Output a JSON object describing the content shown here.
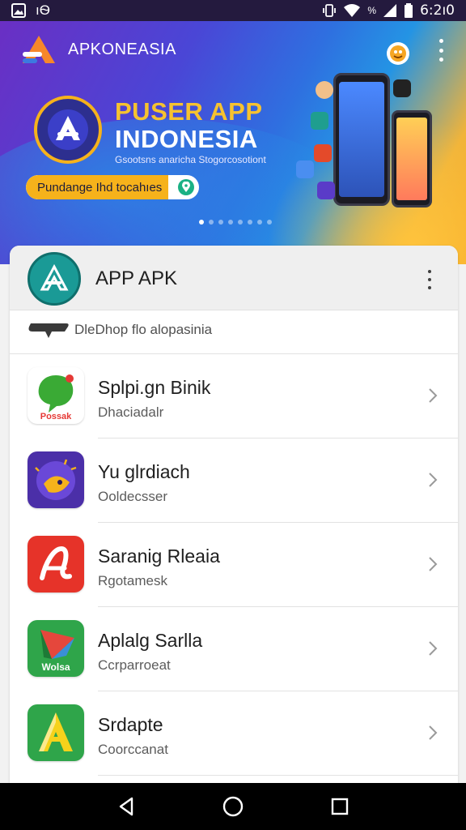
{
  "status_bar": {
    "left_icons": [
      "image-icon",
      "notification-icon"
    ],
    "left_text": "ıѲ",
    "right_icons": [
      "vibrate-icon",
      "wifi-icon",
      "signal-icon",
      "battery-icon"
    ],
    "network_text": "%",
    "time": "6:2ı0"
  },
  "header": {
    "app_name": "APKONEASIA",
    "logo_icon": "apk-logo-icon",
    "avatar_icon": "profile-avatar-icon",
    "menu_icon": "more-vert-icon"
  },
  "banner": {
    "title_line1": "PUSER APP",
    "title_line2": "INDONESIA",
    "subtitle": "Gsootsns anaricha Stogorcosotiont",
    "pill_label": "Pundange Ihd tocahıes",
    "pill_icon": "location-pin-icon",
    "badge_icon": "app-store-badge-icon",
    "page_dots": 8,
    "active_dot": 0,
    "colors": {
      "title_accent": "#f6c230",
      "pill": "#f6b21b"
    }
  },
  "card": {
    "title": "APP APK",
    "logo_icon": "apk-triangle-logo-icon",
    "menu_icon": "more-vert-icon",
    "subheader": "DlеDhop flo alopasinia",
    "subheader_icon": "chat-bubble-icon"
  },
  "apps": [
    {
      "title": "Splpi.gn Binik",
      "subtitle": "Dhaciadalr",
      "icon": "chat-app-icon",
      "icon_label": "Possak",
      "bg": "#ffffff",
      "accent": "#3aaa35"
    },
    {
      "title": "Yu glrdiach",
      "subtitle": "Ooldecsser",
      "icon": "moon-app-icon",
      "icon_label": "",
      "bg": "#4b2fa8",
      "accent": "#f6b21b"
    },
    {
      "title": "Saranig Rleaia",
      "subtitle": "Rgotamesk",
      "icon": "script-a-app-icon",
      "icon_label": "",
      "bg": "#e63329",
      "accent": "#ffffff"
    },
    {
      "title": "Aplalg Sarlla",
      "subtitle": "Ccrparroeat",
      "icon": "play-triangle-app-icon",
      "icon_label": "Wolsa",
      "bg": "#2fa54a",
      "accent": "#e5473c"
    },
    {
      "title": "Srdapte",
      "subtitle": "Coorccanat",
      "icon": "letter-a-app-icon",
      "icon_label": "",
      "bg": "#2fa54a",
      "accent": "#f6d21b"
    }
  ],
  "nav_bar": {
    "back_icon": "back-triangle-icon",
    "home_icon": "home-circle-icon",
    "recents_icon": "recents-square-icon"
  }
}
